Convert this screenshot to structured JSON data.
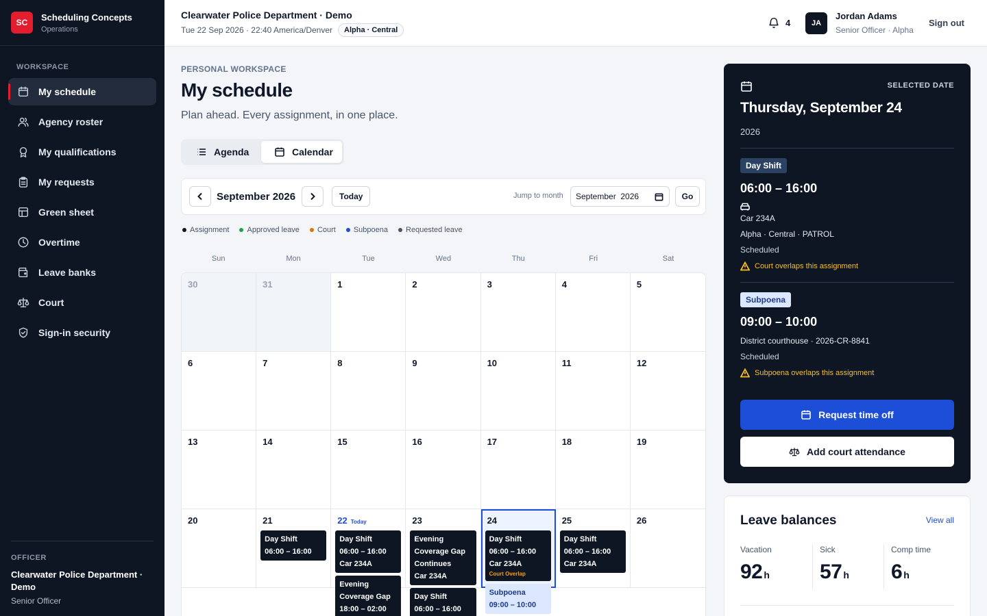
{
  "brand": {
    "logo": "SC",
    "name": "Scheduling Concepts",
    "sub": "Operations"
  },
  "sidebar": {
    "section_label": "WORKSPACE",
    "items": [
      {
        "label": "My schedule",
        "icon": "calendar-icon"
      },
      {
        "label": "Agency roster",
        "icon": "users-icon"
      },
      {
        "label": "My qualifications",
        "icon": "award-icon"
      },
      {
        "label": "My requests",
        "icon": "clipboard-icon"
      },
      {
        "label": "Green sheet",
        "icon": "grid-icon"
      },
      {
        "label": "Overtime",
        "icon": "clock-icon"
      },
      {
        "label": "Leave banks",
        "icon": "wallet-icon"
      },
      {
        "label": "Court",
        "icon": "scale-icon"
      },
      {
        "label": "Sign-in security",
        "icon": "shield-icon"
      }
    ],
    "officer": {
      "label": "OFFICER",
      "dept": "Clearwater Police Department · Demo",
      "role": "Senior Officer"
    }
  },
  "topbar": {
    "title": "Clearwater Police Department · Demo",
    "datetime": "Tue 22 Sep 2026 · 22:40 America/Denver",
    "pill": "Alpha · Central",
    "notifications": "4",
    "avatar": "JA",
    "user_name": "Jordan Adams",
    "user_role": "Senior Officer · Alpha",
    "sign_out": "Sign out"
  },
  "main": {
    "eyebrow": "PERSONAL WORKSPACE",
    "title": "My schedule",
    "subtitle": "Plan ahead. Every assignment, in one place.",
    "views": {
      "agenda": "Agenda",
      "calendar": "Calendar"
    },
    "calendar_bar": {
      "month": "September 2026",
      "today": "Today",
      "jump_label": "Jump to month",
      "jump_value": "September  2026",
      "go": "Go"
    },
    "legend": [
      {
        "label": "Assignment",
        "color": "#0e1624"
      },
      {
        "label": "Approved leave",
        "color": "#16a34a"
      },
      {
        "label": "Court",
        "color": "#d97706"
      },
      {
        "label": "Subpoena",
        "color": "#1d4ed8"
      },
      {
        "label": "Requested leave",
        "color": "#475569"
      }
    ],
    "dow": [
      "Sun",
      "Mon",
      "Tue",
      "Wed",
      "Thu",
      "Fri",
      "Sat"
    ],
    "today_tag": "Today",
    "days": [
      {
        "n": "30",
        "outside": true
      },
      {
        "n": "31",
        "outside": true
      },
      {
        "n": "1"
      },
      {
        "n": "2"
      },
      {
        "n": "3"
      },
      {
        "n": "4"
      },
      {
        "n": "5"
      },
      {
        "n": "6"
      },
      {
        "n": "7"
      },
      {
        "n": "8"
      },
      {
        "n": "9"
      },
      {
        "n": "10"
      },
      {
        "n": "11"
      },
      {
        "n": "12"
      },
      {
        "n": "13"
      },
      {
        "n": "14"
      },
      {
        "n": "15"
      },
      {
        "n": "16"
      },
      {
        "n": "17"
      },
      {
        "n": "18"
      },
      {
        "n": "19"
      },
      {
        "n": "20"
      },
      {
        "n": "21",
        "events": [
          {
            "lines": [
              "Day Shift",
              "06:00 – 16:00"
            ]
          }
        ]
      },
      {
        "n": "22",
        "today": true,
        "events": [
          {
            "lines": [
              "Day Shift",
              "06:00 – 16:00",
              "Car 234A"
            ]
          },
          {
            "lines": [
              "Evening Coverage Gap",
              "18:00 – 02:00"
            ]
          }
        ]
      },
      {
        "n": "23",
        "events": [
          {
            "lines": [
              "Evening Coverage Gap",
              "Continues",
              "Car 234A"
            ]
          },
          {
            "lines": [
              "Day Shift",
              "06:00 – 16:00"
            ]
          }
        ]
      },
      {
        "n": "24",
        "selected": true,
        "events": [
          {
            "lines": [
              "Day Shift",
              "06:00 – 16:00",
              "Car 234A"
            ],
            "warn": "Court Overlap"
          },
          {
            "lines": [
              "Subpoena",
              "09:00 – 10:00"
            ],
            "kind": "subpoena"
          }
        ]
      },
      {
        "n": "25",
        "events": [
          {
            "lines": [
              "Day Shift",
              "06:00 – 16:00",
              "Car 234A"
            ]
          }
        ]
      },
      {
        "n": "26"
      }
    ]
  },
  "detail": {
    "label": "SELECTED DATE",
    "date": "Thursday, September 24",
    "year": "2026",
    "shift": {
      "badge": "Day Shift",
      "time": "06:00 – 16:00",
      "car": "Car 234A",
      "unit": "Alpha · Central · PATROL",
      "status": "Scheduled",
      "warning": "Court overlaps this assignment"
    },
    "subpoena": {
      "badge": "Subpoena",
      "time": "09:00 – 10:00",
      "location": "District courthouse · 2026-CR-8841",
      "status": "Scheduled",
      "warning": "Subpoena overlaps this assignment"
    },
    "request_btn": "Request time off",
    "court_btn": "Add court attendance"
  },
  "leave": {
    "title": "Leave balances",
    "view_all": "View all",
    "balances": [
      {
        "label": "Vacation",
        "value": "92",
        "unit": "h"
      },
      {
        "label": "Sick",
        "value": "57",
        "unit": "h"
      },
      {
        "label": "Comp time",
        "value": "6",
        "unit": "h"
      }
    ]
  }
}
